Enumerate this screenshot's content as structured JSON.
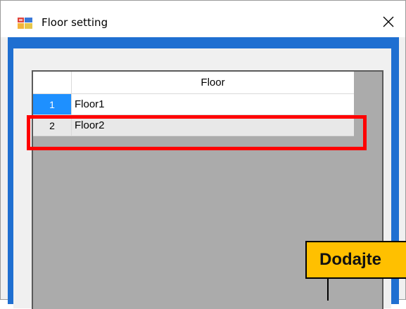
{
  "window": {
    "title": "Floor setting",
    "icon": "app-window-icon",
    "close_glyph": "✕"
  },
  "grid": {
    "column_header": "Floor",
    "rows": [
      {
        "index": "1",
        "value": "Floor1",
        "selected": true
      },
      {
        "index": "2",
        "value": "Floor2",
        "selected": false
      }
    ]
  },
  "annotation": {
    "callout_text": "Dodajte",
    "highlight_color": "#ff0000",
    "callout_color": "#ffc000"
  },
  "colors": {
    "accent": "#1f6fd1",
    "selected_row_header": "#1e90ff",
    "grid_background": "#ababab"
  }
}
